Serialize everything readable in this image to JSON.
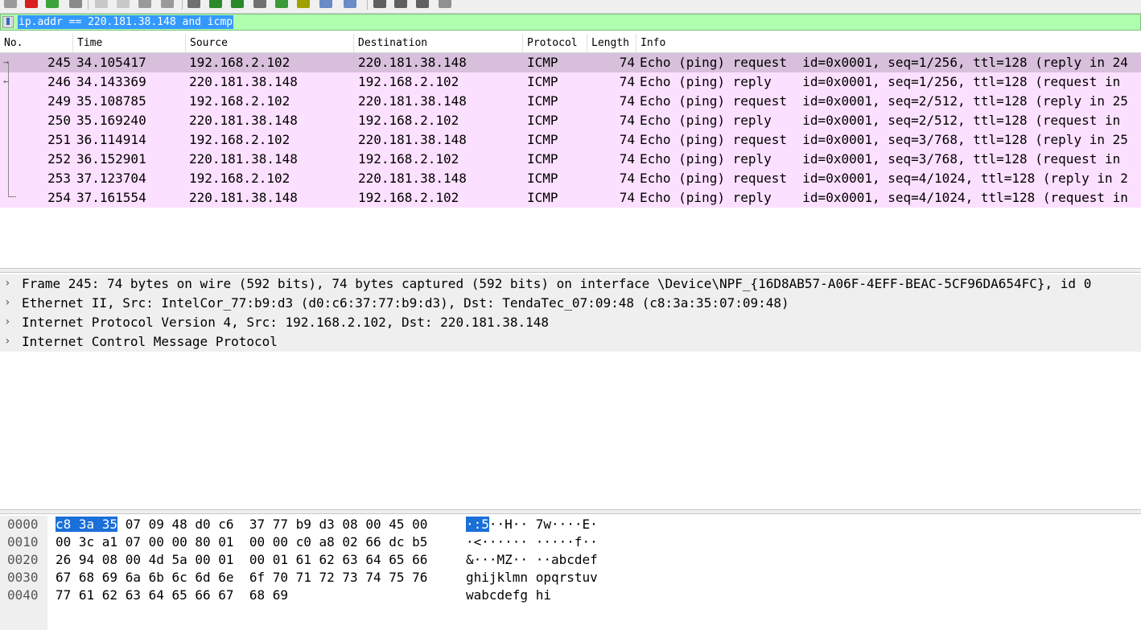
{
  "toolbar": {
    "icons": [
      "toolbar-icon-1",
      "toolbar-icon-2",
      "toolbar-icon-3",
      "toolbar-icon-4",
      "toolbar-icon-5",
      "toolbar-icon-6",
      "toolbar-icon-7",
      "toolbar-icon-8",
      "toolbar-icon-9",
      "toolbar-icon-10",
      "toolbar-icon-11",
      "toolbar-icon-12",
      "toolbar-icon-13",
      "toolbar-icon-14",
      "toolbar-icon-15",
      "toolbar-icon-16",
      "toolbar-icon-17",
      "toolbar-icon-18",
      "toolbar-icon-19",
      "toolbar-icon-20"
    ]
  },
  "filter": {
    "value": "ip.addr == 220.181.38.148 and icmp"
  },
  "packet_list": {
    "columns": [
      "No.",
      "Time",
      "Source",
      "Destination",
      "Protocol",
      "Length",
      "Info"
    ],
    "rows": [
      {
        "no": "245",
        "time": "34.105417",
        "src": "192.168.2.102",
        "dst": "220.181.38.148",
        "proto": "ICMP",
        "len": "74",
        "info": "Echo (ping) request  id=0x0001, seq=1/256, ttl=128 (reply in 24"
      },
      {
        "no": "246",
        "time": "34.143369",
        "src": "220.181.38.148",
        "dst": "192.168.2.102",
        "proto": "ICMP",
        "len": "74",
        "info": "Echo (ping) reply    id=0x0001, seq=1/256, ttl=128 (request in"
      },
      {
        "no": "249",
        "time": "35.108785",
        "src": "192.168.2.102",
        "dst": "220.181.38.148",
        "proto": "ICMP",
        "len": "74",
        "info": "Echo (ping) request  id=0x0001, seq=2/512, ttl=128 (reply in 25"
      },
      {
        "no": "250",
        "time": "35.169240",
        "src": "220.181.38.148",
        "dst": "192.168.2.102",
        "proto": "ICMP",
        "len": "74",
        "info": "Echo (ping) reply    id=0x0001, seq=2/512, ttl=128 (request in"
      },
      {
        "no": "251",
        "time": "36.114914",
        "src": "192.168.2.102",
        "dst": "220.181.38.148",
        "proto": "ICMP",
        "len": "74",
        "info": "Echo (ping) request  id=0x0001, seq=3/768, ttl=128 (reply in 25"
      },
      {
        "no": "252",
        "time": "36.152901",
        "src": "220.181.38.148",
        "dst": "192.168.2.102",
        "proto": "ICMP",
        "len": "74",
        "info": "Echo (ping) reply    id=0x0001, seq=3/768, ttl=128 (request in"
      },
      {
        "no": "253",
        "time": "37.123704",
        "src": "192.168.2.102",
        "dst": "220.181.38.148",
        "proto": "ICMP",
        "len": "74",
        "info": "Echo (ping) request  id=0x0001, seq=4/1024, ttl=128 (reply in 2"
      },
      {
        "no": "254",
        "time": "37.161554",
        "src": "220.181.38.148",
        "dst": "192.168.2.102",
        "proto": "ICMP",
        "len": "74",
        "info": "Echo (ping) reply    id=0x0001, seq=4/1024, ttl=128 (request in"
      }
    ]
  },
  "details": {
    "items": [
      "Frame 245: 74 bytes on wire (592 bits), 74 bytes captured (592 bits) on interface \\Device\\NPF_{16D8AB57-A06F-4EFF-BEAC-5CF96DA654FC}, id 0",
      "Ethernet II, Src: IntelCor_77:b9:d3 (d0:c6:37:77:b9:d3), Dst: TendaTec_07:09:48 (c8:3a:35:07:09:48)",
      "Internet Protocol Version 4, Src: 192.168.2.102, Dst: 220.181.38.148",
      "Internet Control Message Protocol"
    ],
    "expander_glyph": "›"
  },
  "bytes": {
    "rows": [
      {
        "offset": "0000",
        "hex_sel": "c8 3a 35",
        "hex": " 07 09 48 d0 c6  37 77 b9 d3 08 00 45 00",
        "ascii_sel": "·:5",
        "ascii": "··H·· 7w····E·"
      },
      {
        "offset": "0010",
        "hex_sel": "",
        "hex": "00 3c a1 07 00 00 80 01  00 00 c0 a8 02 66 dc b5",
        "ascii_sel": "",
        "ascii": "·<······ ·····f··"
      },
      {
        "offset": "0020",
        "hex_sel": "",
        "hex": "26 94 08 00 4d 5a 00 01  00 01 61 62 63 64 65 66",
        "ascii_sel": "",
        "ascii": "&···MZ·· ··abcdef"
      },
      {
        "offset": "0030",
        "hex_sel": "",
        "hex": "67 68 69 6a 6b 6c 6d 6e  6f 70 71 72 73 74 75 76",
        "ascii_sel": "",
        "ascii": "ghijklmn opqrstuv"
      },
      {
        "offset": "0040",
        "hex_sel": "",
        "hex": "77 61 62 63 64 65 66 67  68 69",
        "ascii_sel": "",
        "ascii": "wabcdefg hi"
      }
    ]
  },
  "colors": {
    "filter_bg": "#afffaf",
    "row_icmp": "#fce0ff",
    "row_selected": "#d8c0dc",
    "highlight": "#1a6fd8"
  }
}
